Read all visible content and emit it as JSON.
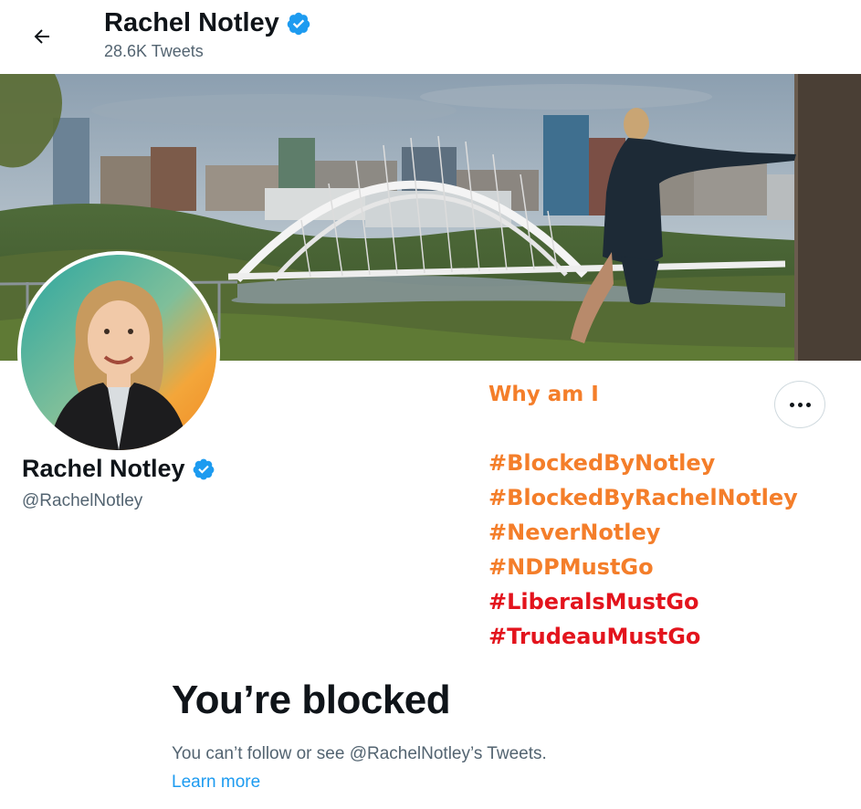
{
  "header": {
    "back_icon": "arrow-left-icon",
    "name": "Rachel Notley",
    "tweet_count": "28.6K Tweets",
    "verified_icon": "verified-badge-icon"
  },
  "profile": {
    "name": "Rachel Notley",
    "handle": "@RachelNotley",
    "more_icon": "more-options-icon"
  },
  "overlay": {
    "question": "Why am I",
    "hashtags": [
      {
        "text": "#BlockedByNotley",
        "color": "#f47e2a"
      },
      {
        "text": "#BlockedByRachelNotley",
        "color": "#f47e2a"
      },
      {
        "text": "#NeverNotley",
        "color": "#f47e2a"
      },
      {
        "text": "#NDPMustGo",
        "color": "#f47e2a"
      },
      {
        "text": "#LiberalsMustGo",
        "color": "#e3141d"
      },
      {
        "text": "#TrudeauMustGo",
        "color": "#e3141d"
      }
    ]
  },
  "blocked": {
    "title": "You’re blocked",
    "description": "You can’t follow or see @RachelNotley’s Tweets.",
    "learn_more": "Learn more"
  },
  "colors": {
    "verified_blue": "#1d9bf0",
    "link_blue": "#1d9bf0",
    "secondary_text": "#536471",
    "overlay_orange": "#f47e2a",
    "overlay_red": "#e3141d"
  }
}
